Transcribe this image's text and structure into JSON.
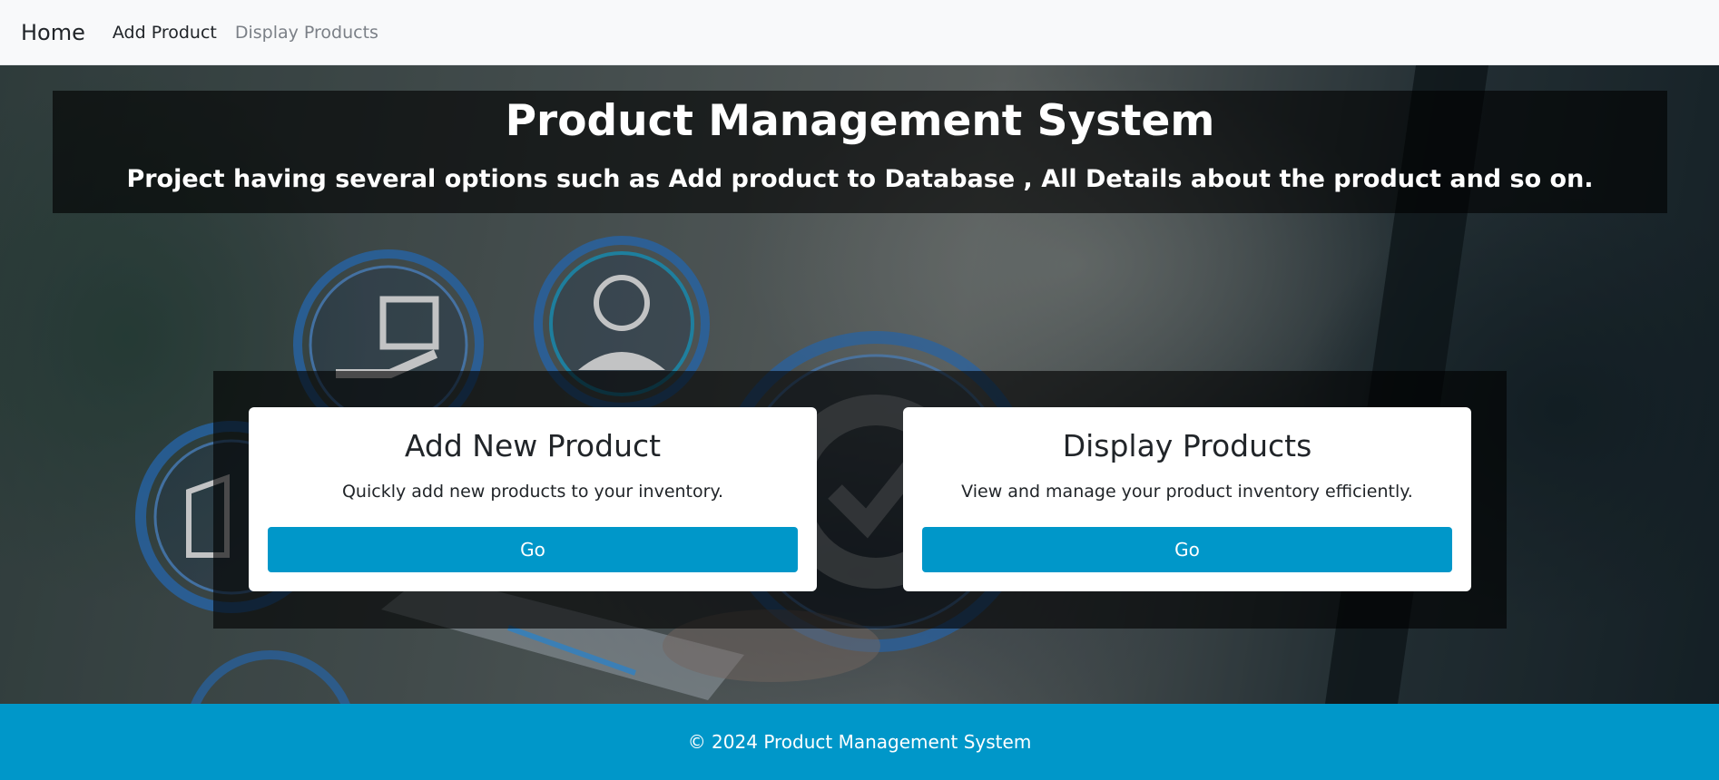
{
  "navbar": {
    "brand": "Home",
    "links": [
      {
        "label": "Add Product"
      },
      {
        "label": "Display Products"
      }
    ]
  },
  "hero": {
    "title": "Product Management System",
    "subtitle": "Project having several options such as Add product to Database , All Details about the product and so on."
  },
  "cards": [
    {
      "title": "Add New Product",
      "text": "Quickly add new products to your inventory.",
      "button": "Go"
    },
    {
      "title": "Display Products",
      "text": "View and manage your product inventory efficiently.",
      "button": "Go"
    }
  ],
  "footer": {
    "text": "© 2024 Product Management System"
  },
  "colors": {
    "accent": "#0097c9",
    "navbar_bg": "#f8f9fa",
    "overlay": "rgba(0,0,0,0.62)"
  },
  "icons": [
    "box-hand-icon",
    "support-agent-icon",
    "gear-check-icon",
    "box-icon"
  ]
}
